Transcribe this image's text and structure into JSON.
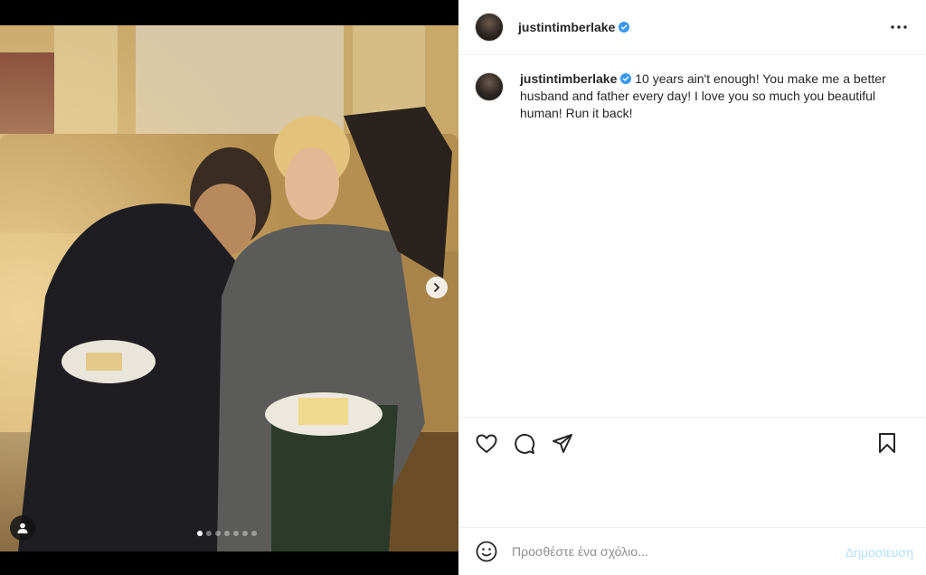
{
  "post": {
    "username": "justintimberlake",
    "caption": "10 years ain't enough! You make me a better husband and father every day! I love you so much you beautiful human! Run it back!",
    "media": {
      "slide_count": 7,
      "active_slide": 1
    }
  },
  "comment": {
    "placeholder": "Προσθέστε ένα σχόλιο...",
    "post_label": "Δημοσίευση"
  },
  "icons": {
    "verified": "verified-badge-icon",
    "more": "more-options-icon",
    "like": "heart-icon",
    "comment": "comment-icon",
    "share": "send-icon",
    "save": "bookmark-icon",
    "emoji": "emoji-icon",
    "next": "chevron-right-icon",
    "tag": "user-tag-icon"
  },
  "colors": {
    "verified": "#3897f0",
    "post_button": "#b2dffc"
  }
}
